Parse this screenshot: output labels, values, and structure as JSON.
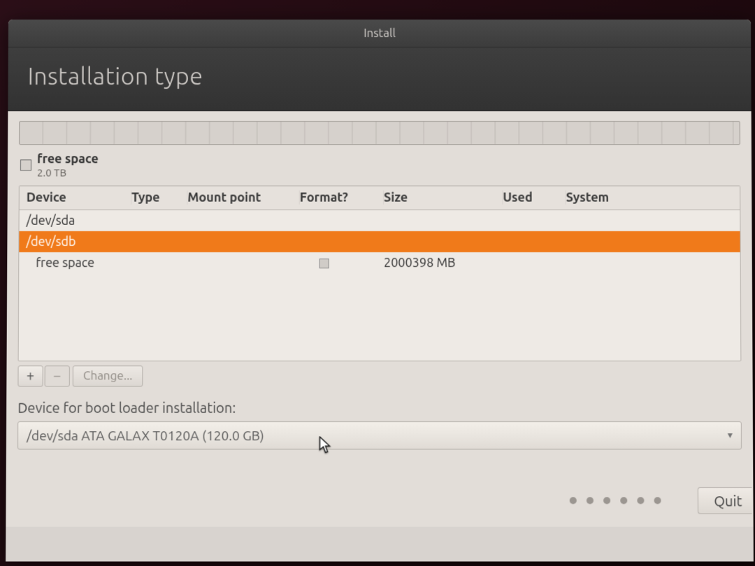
{
  "window": {
    "title": "Install",
    "page_title": "Installation type"
  },
  "legend": {
    "name": "free space",
    "size": "2.0 TB"
  },
  "table": {
    "headers": {
      "device": "Device",
      "type": "Type",
      "mount": "Mount point",
      "format": "Format?",
      "size": "Size",
      "used": "Used",
      "system": "System"
    },
    "rows": [
      {
        "device": "/dev/sda",
        "type": "",
        "mount": "",
        "format": "",
        "size": "",
        "used": "",
        "system": "",
        "selected": false,
        "indent": false
      },
      {
        "device": "/dev/sdb",
        "type": "",
        "mount": "",
        "format": "",
        "size": "",
        "used": "",
        "system": "",
        "selected": true,
        "indent": false
      },
      {
        "device": "free space",
        "type": "",
        "mount": "",
        "format": "box",
        "size": "2000398 MB",
        "used": "",
        "system": "",
        "selected": false,
        "indent": true
      }
    ]
  },
  "toolbar": {
    "add": "+",
    "remove": "−",
    "change": "Change..."
  },
  "bootloader": {
    "label": "Device for boot loader installation:",
    "value": "/dev/sda   ATA GALAX T0120A (120.0 GB)"
  },
  "footer": {
    "quit": "Quit"
  }
}
